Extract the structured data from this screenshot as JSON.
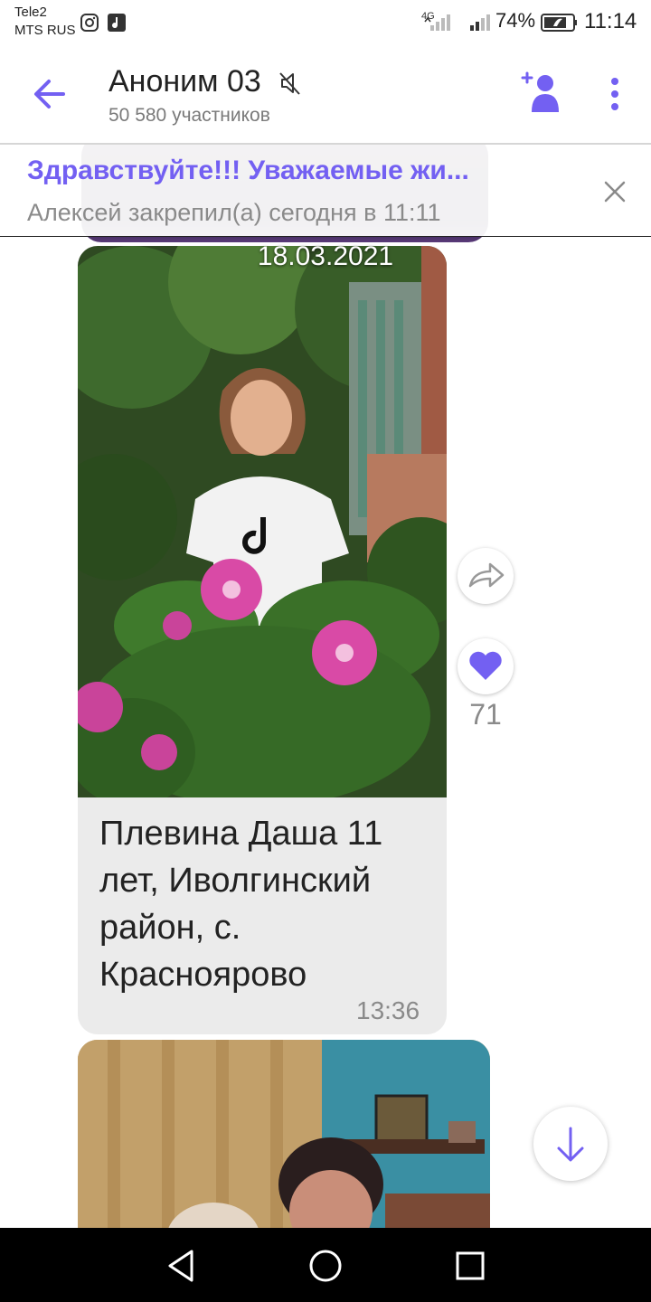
{
  "status_bar": {
    "carrier_1": "Tele2",
    "carrier_2": "MTS RUS",
    "network": "4G",
    "battery": "74%",
    "time": "11:14"
  },
  "header": {
    "title": "Аноним 03",
    "subtitle": "50 580 участников",
    "icons": [
      "back-arrow-icon",
      "mute-icon",
      "add-participant-icon",
      "more-vert-icon"
    ]
  },
  "pinned": {
    "title": "Здравствуйте!!! Уважаемые жи...",
    "subtitle": "Алексей закрепил(а) сегодня в 11:11"
  },
  "message": {
    "date": "18.03.2021",
    "caption": "Плевина Даша 11 лет, Иволгинский район, с. Красноярово",
    "time": "13:36",
    "likes": "71"
  },
  "nav": {
    "icons": [
      "back-triangle-icon",
      "home-circle-icon",
      "recents-square-icon"
    ]
  },
  "colors": {
    "accent": "#7360f2",
    "header_bg": "#ffffff",
    "bubble_bg": "#ebebeb",
    "navbar_bg": "#000000"
  }
}
